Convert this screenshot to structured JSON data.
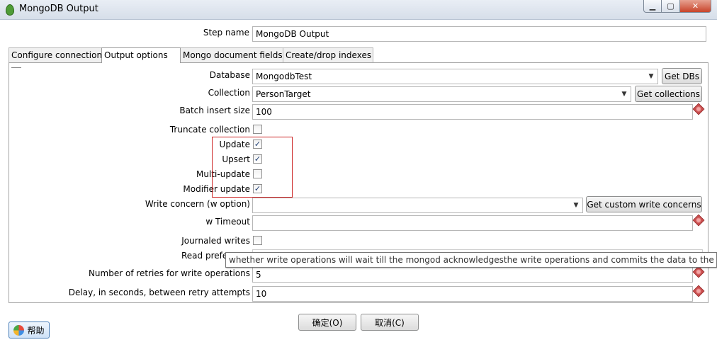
{
  "window": {
    "title": "MongoDB Output",
    "minimize_glyph": "▁",
    "maximize_glyph": "▢",
    "close_glyph": "✕"
  },
  "step_name": {
    "label": "Step name",
    "value": "MongoDB Output"
  },
  "tabs": [
    {
      "label": "Configure connection"
    },
    {
      "label": "Output options",
      "active": true
    },
    {
      "label": "Mongo document fields"
    },
    {
      "label": "Create/drop indexes"
    }
  ],
  "form": {
    "database": {
      "label": "Database",
      "value": "MongodbTest",
      "button": "Get DBs"
    },
    "collection": {
      "label": "Collection",
      "value": "PersonTarget",
      "button": "Get collections"
    },
    "batch_insert_size": {
      "label": "Batch insert size",
      "value": "100"
    },
    "truncate_collection": {
      "label": "Truncate collection",
      "checked": false,
      "mark": ""
    },
    "update": {
      "label": "Update",
      "checked": true,
      "mark": "✓"
    },
    "upsert": {
      "label": "Upsert",
      "checked": true,
      "mark": "✓"
    },
    "multi_update": {
      "label": "Multi-update",
      "checked": false,
      "mark": ""
    },
    "modifier_update": {
      "label": "Modifier update",
      "checked": true,
      "mark": "✓"
    },
    "write_concern": {
      "label": "Write concern (w option)",
      "value": "",
      "button": "Get custom write concerns"
    },
    "w_timeout": {
      "label": "w Timeout",
      "value": ""
    },
    "journaled_writes": {
      "label": "Journaled writes",
      "checked": false,
      "mark": ""
    },
    "read_preference": {
      "label": "Read prefe"
    },
    "num_retries": {
      "label": "Number of retries for write operations",
      "value": "5"
    },
    "retry_delay": {
      "label": "Delay, in seconds, between retry attempts",
      "value": "10"
    }
  },
  "tooltip": "whether write operations will wait till the mongod acknowledgesthe write operations and commits the data to the on d",
  "buttons": {
    "ok": "确定(O)",
    "cancel": "取消(C)",
    "help": "帮助"
  },
  "icons": {
    "combo_arrow": "▼"
  },
  "colors": {
    "highlight_box": "#cc2222",
    "variable_icon": "#c94a4a"
  }
}
